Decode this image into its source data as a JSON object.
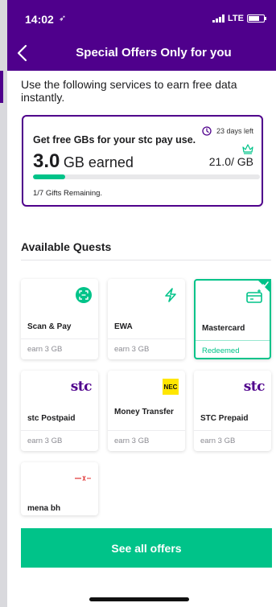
{
  "status_bar": {
    "time": "14:02",
    "location_glyph": "➶",
    "network": "LTE"
  },
  "nav": {
    "title": "Special Offers Only for you"
  },
  "intro": "Use the following services to earn free data instantly.",
  "summary_card": {
    "days_left": "23 days left",
    "headline": "Get free GBs for your stc pay use.",
    "earned_value": "3.0",
    "earned_unit": "GB earned",
    "total": "21.0/ GB",
    "progress_fraction": 0.143,
    "gifts_remaining": "1/7 Gifts Remaining."
  },
  "section": {
    "title": "Available Quests"
  },
  "quests": [
    {
      "name": "Scan & Pay",
      "earn": "earn 3 GB",
      "icon": "scan-icon",
      "logo_text": ""
    },
    {
      "name": "EWA",
      "earn": "earn 3 GB",
      "icon": "lightning-icon",
      "logo_text": ""
    },
    {
      "name": "Mastercard",
      "earn": "Redeemed",
      "icon": "card-icon",
      "logo_text": ""
    },
    {
      "name": "stc Postpaid",
      "earn": "earn 3 GB",
      "icon": "stc-logo",
      "logo_text": "stc"
    },
    {
      "name": "Money Transfer",
      "earn": "earn 3 GB",
      "icon": "nec-logo",
      "logo_text": "NEC"
    },
    {
      "name": "STC Prepaid",
      "earn": "earn 3 GB",
      "icon": "stc-logo",
      "logo_text": "stc"
    },
    {
      "name": "mena bh",
      "earn": "",
      "icon": "mena-logo",
      "logo_text": ""
    }
  ],
  "cta": {
    "label": "See all offers"
  },
  "colors": {
    "brand_purple": "#4f008c",
    "accent_green": "#00c389"
  }
}
